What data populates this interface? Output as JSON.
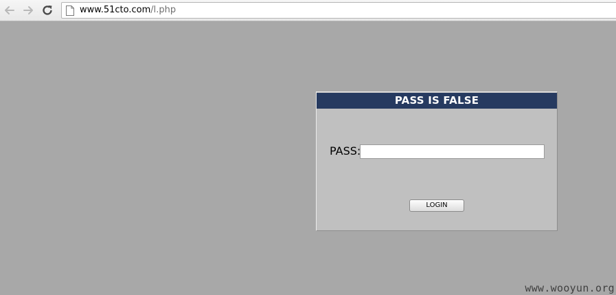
{
  "browser": {
    "url_host": "www.51cto.com",
    "url_path": "/l.php",
    "icons": {
      "back": "arrow-left-icon",
      "forward": "arrow-right-icon",
      "reload": "reload-icon",
      "page": "page-icon"
    }
  },
  "login": {
    "title": "PASS IS FALSE",
    "pass_label": "PASS:",
    "pass_value": "",
    "button_label": "LOGIN"
  },
  "watermark": "www.wooyun.org",
  "colors": {
    "page_background": "#a8a8a8",
    "panel_background": "#c0c0c0",
    "title_bar": "#263a60"
  }
}
